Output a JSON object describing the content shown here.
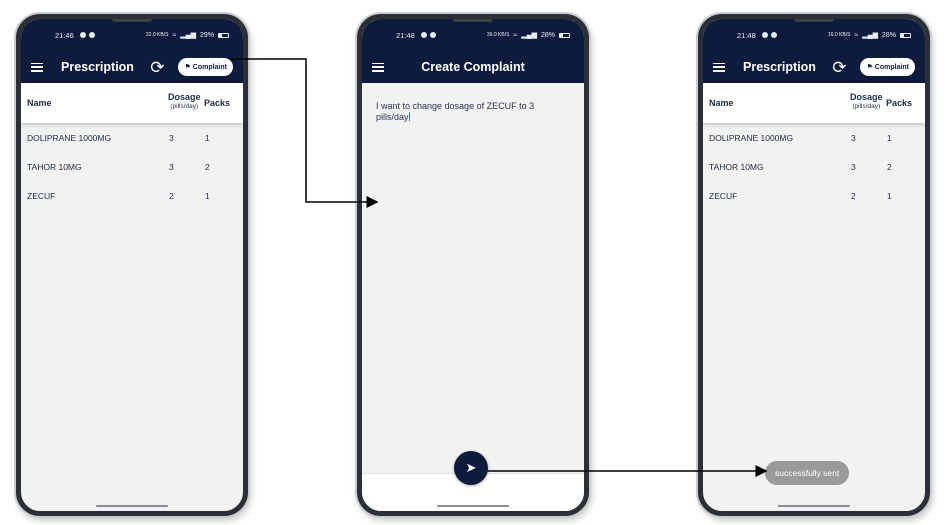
{
  "screen1": {
    "status": {
      "time": "21:46",
      "signal": "32.0 KB/S",
      "battery": "29%"
    },
    "appbar": {
      "title": "Prescription",
      "complaint_label": "Complaint"
    },
    "table": {
      "headers": {
        "name": "Name",
        "dosage": "Dosage",
        "dosage_unit": "(pills/day)",
        "packs": "Packs"
      },
      "rows": [
        {
          "name": "DOLIPRANE 1000MG",
          "dosage": "3",
          "packs": "1"
        },
        {
          "name": "TAHOR 10MG",
          "dosage": "3",
          "packs": "2"
        },
        {
          "name": "ZECUF",
          "dosage": "2",
          "packs": "1"
        }
      ]
    }
  },
  "screen2": {
    "status": {
      "time": "21:48",
      "signal": "39.0 KB/S",
      "battery": "28%"
    },
    "appbar": {
      "title": "Create Complaint"
    },
    "complaint_text": "I want to change dosage of ZECUF to 3 pills/day"
  },
  "screen3": {
    "status": {
      "time": "21:48",
      "signal": "16.0 KB/S",
      "battery": "28%"
    },
    "appbar": {
      "title": "Prescription",
      "complaint_label": "Complaint"
    },
    "table": {
      "headers": {
        "name": "Name",
        "dosage": "Dosage",
        "dosage_unit": "(pills/day)",
        "packs": "Packs"
      },
      "rows": [
        {
          "name": "DOLIPRANE 1000MG",
          "dosage": "3",
          "packs": "1"
        },
        {
          "name": "TAHOR 10MG",
          "dosage": "3",
          "packs": "2"
        },
        {
          "name": "ZECUF",
          "dosage": "2",
          "packs": "1"
        }
      ]
    },
    "toast": "successfully sent"
  },
  "icons": {
    "menu": "hamburger-icon",
    "refresh": "refresh-icon",
    "flag": "flag-icon",
    "send": "send-icon"
  },
  "colors": {
    "appbar": "#0e1b3d",
    "background": "#f2f2f2",
    "toast": "#9a9a9a"
  }
}
